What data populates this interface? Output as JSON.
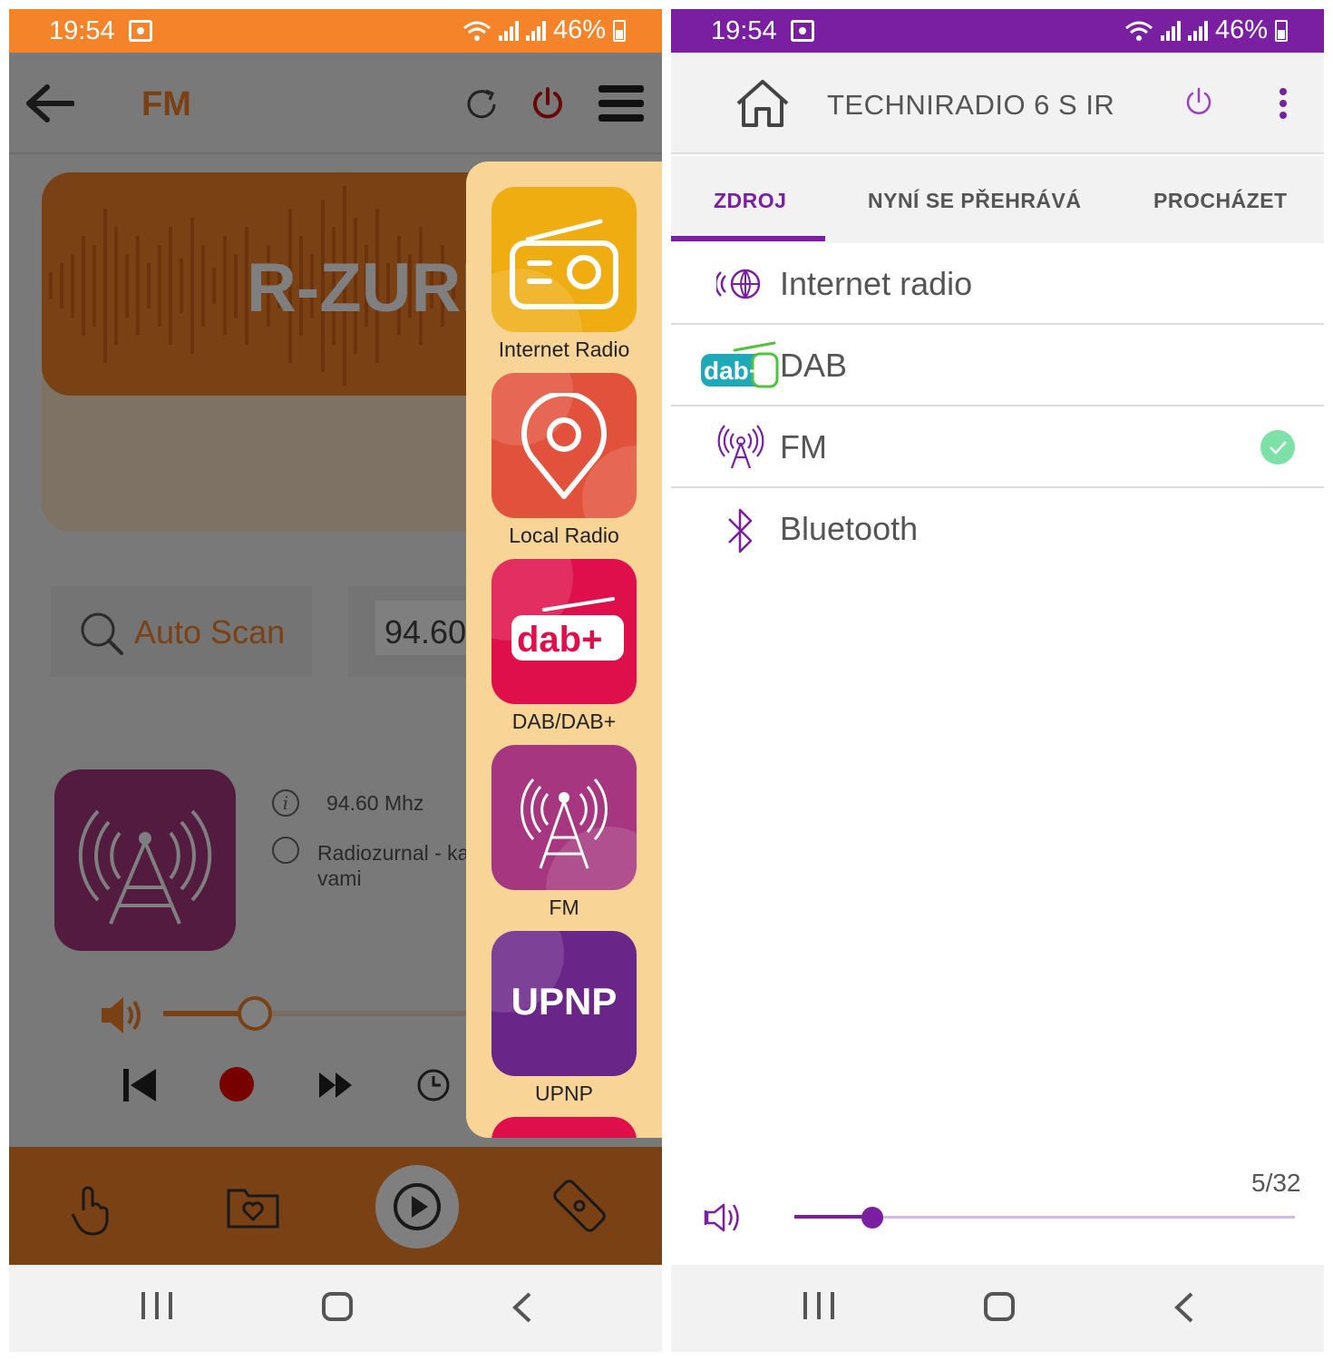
{
  "status": {
    "time": "19:54",
    "battery": "46%"
  },
  "left": {
    "status_color": "#f5832a",
    "accent": "#f5832a",
    "title": "FM",
    "station_banner": "R-ZURI",
    "auto_scan": "Auto Scan",
    "frequency_input": "94.60",
    "info_frequency": "94.60 Mhz",
    "info_station": "Radiozurnal - ka vami",
    "volume_level_percent": 28,
    "sources": [
      {
        "label": "Internet Radio",
        "color": "#f0ad12",
        "icon": "radio-icon"
      },
      {
        "label": "Local Radio",
        "color": "#e2513b",
        "icon": "location-pin-icon"
      },
      {
        "label": "DAB/DAB+",
        "color": "#de0f4a",
        "icon": "dab-plus-icon",
        "logo_text": "dab+"
      },
      {
        "label": "FM",
        "color": "#a5367f",
        "icon": "antenna-tower-icon"
      },
      {
        "label": "UPNP",
        "color": "#6a2589",
        "icon": "upnp-icon",
        "logo_text": "UPNP"
      }
    ]
  },
  "right": {
    "status_color": "#7b1fa2",
    "accent": "#7b1fa2",
    "title": "TECHNIRADIO 6 S IR",
    "tabs": [
      "ZDROJ",
      "NYNÍ SE PŘEHRÁVÁ",
      "PROCHÁZET"
    ],
    "active_tab": 0,
    "sources": [
      {
        "label": "Internet radio",
        "icon": "internet-radio-icon"
      },
      {
        "label": "DAB",
        "icon": "dab-plus-logo-icon",
        "logo_text": "dab+"
      },
      {
        "label": "FM",
        "icon": "fm-antenna-icon",
        "selected": true
      },
      {
        "label": "Bluetooth",
        "icon": "bluetooth-icon"
      }
    ],
    "volume": {
      "value": 5,
      "max": 32,
      "display": "5/32"
    }
  }
}
